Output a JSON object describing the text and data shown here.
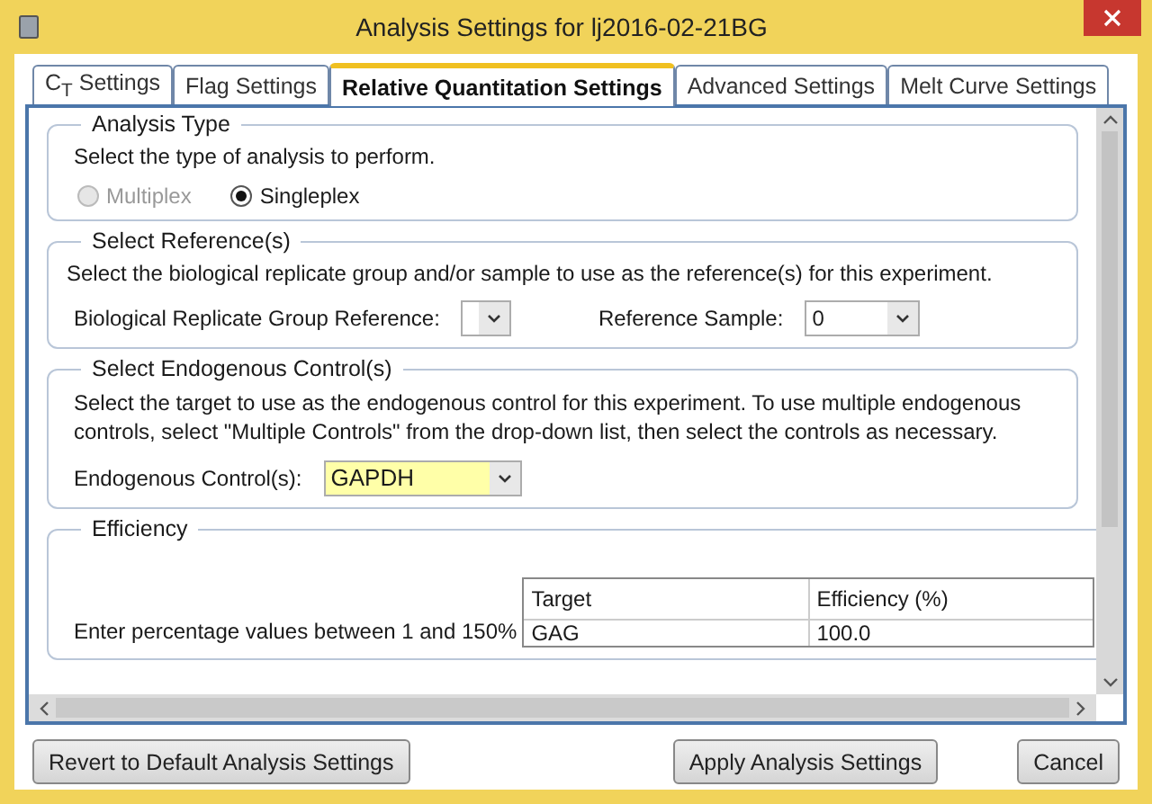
{
  "window": {
    "title": "Analysis Settings for lj2016-02-21BG"
  },
  "tabs": [
    {
      "label": "C$_{T}$ Settings",
      "selected": false
    },
    {
      "label": "Flag Settings",
      "selected": false
    },
    {
      "label": "Relative Quantitation Settings",
      "selected": true
    },
    {
      "label": "Advanced Settings",
      "selected": false
    },
    {
      "label": "Melt Curve Settings",
      "selected": false
    }
  ],
  "analysis_type": {
    "title": "Analysis Type",
    "description": "Select the type of analysis to perform.",
    "options": [
      {
        "label": "Multiplex",
        "selected": false,
        "disabled": true
      },
      {
        "label": "Singleplex",
        "selected": true,
        "disabled": false
      }
    ]
  },
  "references": {
    "title": "Select Reference(s)",
    "description": "Select the biological replicate group and/or sample to use as the reference(s) for this experiment.",
    "group_label": "Biological Replicate Group Reference:",
    "sample_label": "Reference Sample:",
    "sample_value": "0"
  },
  "endogenous": {
    "title": "Select Endogenous Control(s)",
    "description": "Select the target to use as the endogenous control for this experiment. To use multiple endogenous controls, select \"Multiple Controls\" from the drop-down list, then select the controls as necessary.",
    "label": "Endogenous Control(s):",
    "value": "GAPDH"
  },
  "efficiency": {
    "title": "Efficiency",
    "instruction": "Enter percentage values between 1 and 150%",
    "columns": [
      "Target",
      "Efficiency (%)"
    ],
    "rows": [
      [
        "GAG",
        "100.0"
      ]
    ]
  },
  "buttons": [
    "Revert to Default Analysis Settings",
    "Apply Analysis Settings",
    "Cancel"
  ]
}
